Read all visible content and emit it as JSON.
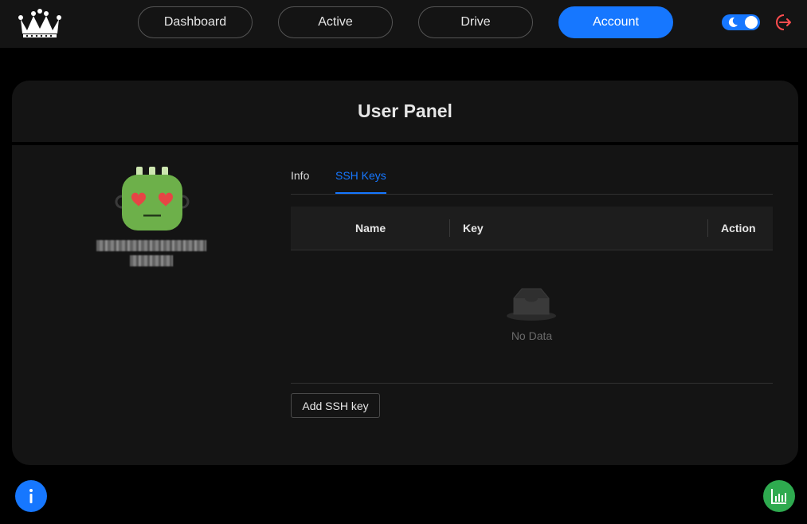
{
  "nav": {
    "items": [
      {
        "label": "Dashboard",
        "active": false
      },
      {
        "label": "Active",
        "active": false
      },
      {
        "label": "Drive",
        "active": false
      },
      {
        "label": "Account",
        "active": true
      }
    ]
  },
  "header": {
    "logo_icon": "crown-icon",
    "theme_toggle_icon": "moon-icon",
    "logout_icon": "logout-icon"
  },
  "panel": {
    "title": "User Panel"
  },
  "tabs": [
    {
      "label": "Info",
      "active": false
    },
    {
      "label": "SSH Keys",
      "active": true
    }
  ],
  "table": {
    "columns": [
      "Name",
      "Key",
      "Action"
    ],
    "rows": [],
    "empty_text": "No Data"
  },
  "actions": {
    "add_ssh_key": "Add SSH key"
  },
  "fabs": {
    "info_icon": "info-icon",
    "stats_icon": "bar-chart-icon"
  },
  "colors": {
    "accent": "#1677ff",
    "success": "#2eaa4f",
    "logout": "#ff4d4f"
  }
}
